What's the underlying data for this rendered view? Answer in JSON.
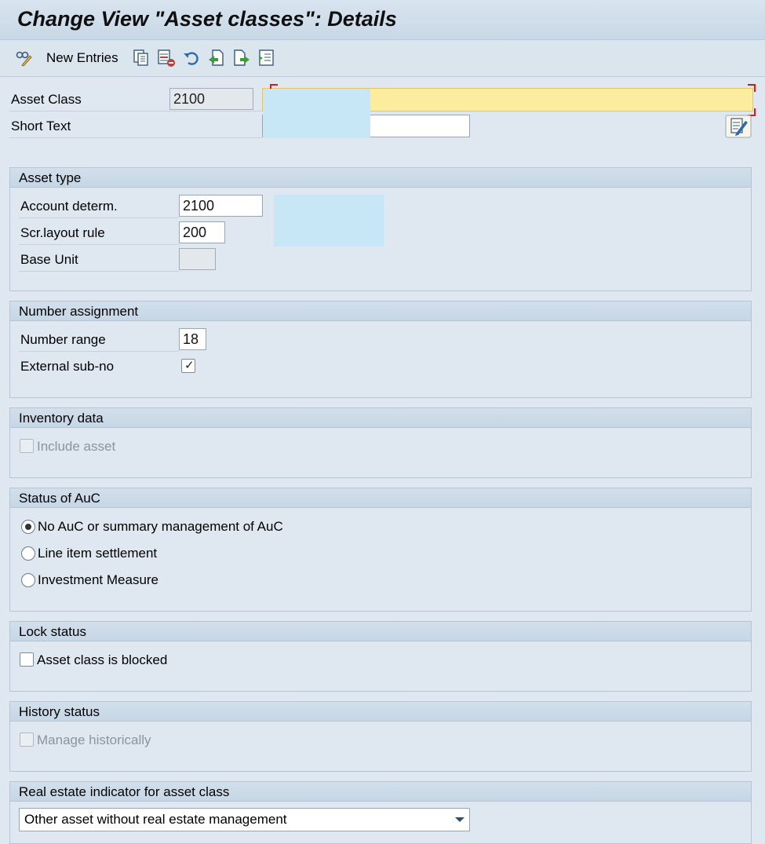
{
  "window": {
    "title": "Change View \"Asset classes\": Details"
  },
  "toolbar": {
    "new_entries_label": "New Entries",
    "icons": [
      "display-change-icon",
      "copy-icon",
      "delete-icon",
      "undo-icon",
      "previous-entry-icon",
      "next-entry-icon",
      "select-all-icon"
    ]
  },
  "header": {
    "asset_class_label": "Asset Class",
    "asset_class_value": "2100",
    "short_text_label": "Short Text",
    "short_text_value": ""
  },
  "asset_type": {
    "title": "Asset type",
    "account_determ_label": "Account determ.",
    "account_determ_value": "2100",
    "scr_layout_label": "Scr.layout rule",
    "scr_layout_value": "200",
    "base_unit_label": "Base Unit",
    "base_unit_value": ""
  },
  "number_assignment": {
    "title": "Number assignment",
    "number_range_label": "Number range",
    "number_range_value": "18",
    "external_subno_label": "External sub-no",
    "external_subno_checked": true
  },
  "inventory_data": {
    "title": "Inventory data",
    "include_asset_label": "Include asset",
    "include_asset_checked": false
  },
  "status_auc": {
    "title": "Status of AuC",
    "options": [
      {
        "label": "No AuC or summary management of AuC",
        "selected": true
      },
      {
        "label": "Line item settlement",
        "selected": false
      },
      {
        "label": "Investment Measure",
        "selected": false
      }
    ]
  },
  "lock_status": {
    "title": "Lock status",
    "blocked_label": "Asset class is blocked",
    "blocked_checked": false
  },
  "history_status": {
    "title": "History status",
    "manage_hist_label": "Manage historically",
    "manage_hist_checked": false
  },
  "real_estate": {
    "title": "Real estate indicator for asset class",
    "selected": "Other asset without real estate management"
  }
}
